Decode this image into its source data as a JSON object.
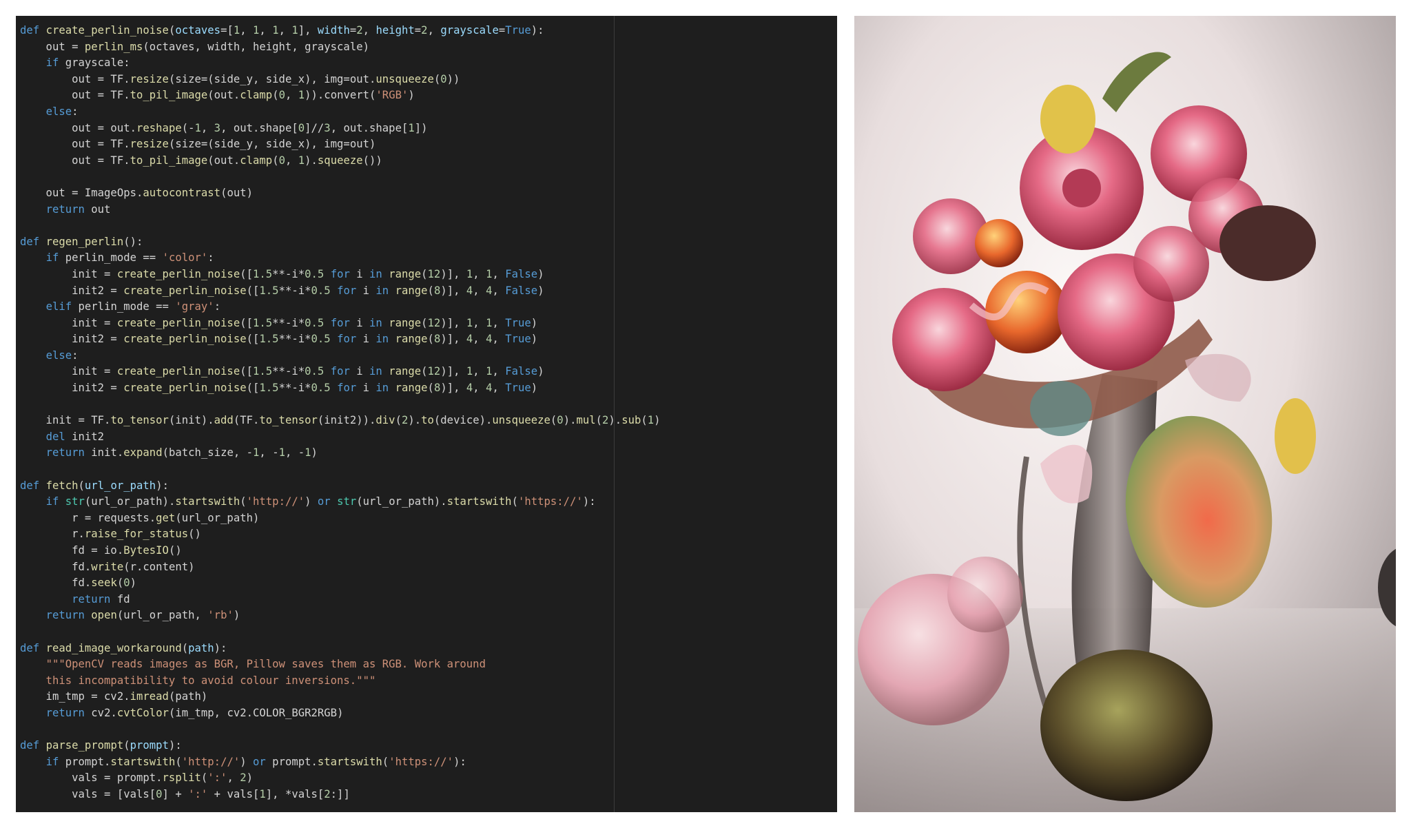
{
  "code_lines": [
    [
      [
        "kw",
        "def "
      ],
      [
        "fn",
        "create_perlin_noise"
      ],
      [
        "p",
        "("
      ],
      [
        "pm",
        "octaves"
      ],
      [
        "p",
        "=["
      ],
      [
        "nm",
        "1"
      ],
      [
        "p",
        ", "
      ],
      [
        "nm",
        "1"
      ],
      [
        "p",
        ", "
      ],
      [
        "nm",
        "1"
      ],
      [
        "p",
        ", "
      ],
      [
        "nm",
        "1"
      ],
      [
        "p",
        "], "
      ],
      [
        "pm",
        "width"
      ],
      [
        "p",
        "="
      ],
      [
        "nm",
        "2"
      ],
      [
        "p",
        ", "
      ],
      [
        "pm",
        "height"
      ],
      [
        "p",
        "="
      ],
      [
        "nm",
        "2"
      ],
      [
        "p",
        ", "
      ],
      [
        "pm",
        "grayscale"
      ],
      [
        "p",
        "="
      ],
      [
        "kw",
        "True"
      ],
      [
        "p",
        "):"
      ]
    ],
    [
      [
        "p",
        "    out = "
      ],
      [
        "fn",
        "perlin_ms"
      ],
      [
        "p",
        "(octaves, width, height, grayscale)"
      ]
    ],
    [
      [
        "p",
        "    "
      ],
      [
        "kw",
        "if"
      ],
      [
        "p",
        " grayscale:"
      ]
    ],
    [
      [
        "p",
        "        out = TF."
      ],
      [
        "fn",
        "resize"
      ],
      [
        "p",
        "(size=(side_y, side_x), img=out."
      ],
      [
        "fn",
        "unsqueeze"
      ],
      [
        "p",
        "("
      ],
      [
        "nm",
        "0"
      ],
      [
        "p",
        "))"
      ]
    ],
    [
      [
        "p",
        "        out = TF."
      ],
      [
        "fn",
        "to_pil_image"
      ],
      [
        "p",
        "(out."
      ],
      [
        "fn",
        "clamp"
      ],
      [
        "p",
        "("
      ],
      [
        "nm",
        "0"
      ],
      [
        "p",
        ", "
      ],
      [
        "nm",
        "1"
      ],
      [
        "p",
        ")).convert("
      ],
      [
        "st",
        "'RGB'"
      ],
      [
        "p",
        ")"
      ]
    ],
    [
      [
        "p",
        "    "
      ],
      [
        "kw",
        "else"
      ],
      [
        "p",
        ":"
      ]
    ],
    [
      [
        "p",
        "        out = out."
      ],
      [
        "fn",
        "reshape"
      ],
      [
        "p",
        "(-"
      ],
      [
        "nm",
        "1"
      ],
      [
        "p",
        ", "
      ],
      [
        "nm",
        "3"
      ],
      [
        "p",
        ", out.shape["
      ],
      [
        "nm",
        "0"
      ],
      [
        "p",
        "]//"
      ],
      [
        "nm",
        "3"
      ],
      [
        "p",
        ", out.shape["
      ],
      [
        "nm",
        "1"
      ],
      [
        "p",
        "])"
      ]
    ],
    [
      [
        "p",
        "        out = TF."
      ],
      [
        "fn",
        "resize"
      ],
      [
        "p",
        "(size=(side_y, side_x), img=out)"
      ]
    ],
    [
      [
        "p",
        "        out = TF."
      ],
      [
        "fn",
        "to_pil_image"
      ],
      [
        "p",
        "(out."
      ],
      [
        "fn",
        "clamp"
      ],
      [
        "p",
        "("
      ],
      [
        "nm",
        "0"
      ],
      [
        "p",
        ", "
      ],
      [
        "nm",
        "1"
      ],
      [
        "p",
        ")."
      ],
      [
        "fn",
        "squeeze"
      ],
      [
        "p",
        "())"
      ]
    ],
    [],
    [
      [
        "p",
        "    out = ImageOps."
      ],
      [
        "fn",
        "autocontrast"
      ],
      [
        "p",
        "(out)"
      ]
    ],
    [
      [
        "p",
        "    "
      ],
      [
        "kw",
        "return"
      ],
      [
        "p",
        " out"
      ]
    ],
    [],
    [
      [
        "kw",
        "def "
      ],
      [
        "fn",
        "regen_perlin"
      ],
      [
        "p",
        "():"
      ]
    ],
    [
      [
        "p",
        "    "
      ],
      [
        "kw",
        "if"
      ],
      [
        "p",
        " perlin_mode == "
      ],
      [
        "st",
        "'color'"
      ],
      [
        "p",
        ":"
      ]
    ],
    [
      [
        "p",
        "        init = "
      ],
      [
        "fn",
        "create_perlin_noise"
      ],
      [
        "p",
        "(["
      ],
      [
        "nm",
        "1.5"
      ],
      [
        "p",
        "**-i*"
      ],
      [
        "nm",
        "0.5"
      ],
      [
        "p",
        " "
      ],
      [
        "kw",
        "for"
      ],
      [
        "p",
        " i "
      ],
      [
        "kw",
        "in"
      ],
      [
        "p",
        " "
      ],
      [
        "fn",
        "range"
      ],
      [
        "p",
        "("
      ],
      [
        "nm",
        "12"
      ],
      [
        "p",
        ")], "
      ],
      [
        "nm",
        "1"
      ],
      [
        "p",
        ", "
      ],
      [
        "nm",
        "1"
      ],
      [
        "p",
        ", "
      ],
      [
        "kw",
        "False"
      ],
      [
        "p",
        ")"
      ]
    ],
    [
      [
        "p",
        "        init2 = "
      ],
      [
        "fn",
        "create_perlin_noise"
      ],
      [
        "p",
        "(["
      ],
      [
        "nm",
        "1.5"
      ],
      [
        "p",
        "**-i*"
      ],
      [
        "nm",
        "0.5"
      ],
      [
        "p",
        " "
      ],
      [
        "kw",
        "for"
      ],
      [
        "p",
        " i "
      ],
      [
        "kw",
        "in"
      ],
      [
        "p",
        " "
      ],
      [
        "fn",
        "range"
      ],
      [
        "p",
        "("
      ],
      [
        "nm",
        "8"
      ],
      [
        "p",
        ")], "
      ],
      [
        "nm",
        "4"
      ],
      [
        "p",
        ", "
      ],
      [
        "nm",
        "4"
      ],
      [
        "p",
        ", "
      ],
      [
        "kw",
        "False"
      ],
      [
        "p",
        ")"
      ]
    ],
    [
      [
        "p",
        "    "
      ],
      [
        "kw",
        "elif"
      ],
      [
        "p",
        " perlin_mode == "
      ],
      [
        "st",
        "'gray'"
      ],
      [
        "p",
        ":"
      ]
    ],
    [
      [
        "p",
        "        init = "
      ],
      [
        "fn",
        "create_perlin_noise"
      ],
      [
        "p",
        "(["
      ],
      [
        "nm",
        "1.5"
      ],
      [
        "p",
        "**-i*"
      ],
      [
        "nm",
        "0.5"
      ],
      [
        "p",
        " "
      ],
      [
        "kw",
        "for"
      ],
      [
        "p",
        " i "
      ],
      [
        "kw",
        "in"
      ],
      [
        "p",
        " "
      ],
      [
        "fn",
        "range"
      ],
      [
        "p",
        "("
      ],
      [
        "nm",
        "12"
      ],
      [
        "p",
        ")], "
      ],
      [
        "nm",
        "1"
      ],
      [
        "p",
        ", "
      ],
      [
        "nm",
        "1"
      ],
      [
        "p",
        ", "
      ],
      [
        "kw",
        "True"
      ],
      [
        "p",
        ")"
      ]
    ],
    [
      [
        "p",
        "        init2 = "
      ],
      [
        "fn",
        "create_perlin_noise"
      ],
      [
        "p",
        "(["
      ],
      [
        "nm",
        "1.5"
      ],
      [
        "p",
        "**-i*"
      ],
      [
        "nm",
        "0.5"
      ],
      [
        "p",
        " "
      ],
      [
        "kw",
        "for"
      ],
      [
        "p",
        " i "
      ],
      [
        "kw",
        "in"
      ],
      [
        "p",
        " "
      ],
      [
        "fn",
        "range"
      ],
      [
        "p",
        "("
      ],
      [
        "nm",
        "8"
      ],
      [
        "p",
        ")], "
      ],
      [
        "nm",
        "4"
      ],
      [
        "p",
        ", "
      ],
      [
        "nm",
        "4"
      ],
      [
        "p",
        ", "
      ],
      [
        "kw",
        "True"
      ],
      [
        "p",
        ")"
      ]
    ],
    [
      [
        "p",
        "    "
      ],
      [
        "kw",
        "else"
      ],
      [
        "p",
        ":"
      ]
    ],
    [
      [
        "p",
        "        init = "
      ],
      [
        "fn",
        "create_perlin_noise"
      ],
      [
        "p",
        "(["
      ],
      [
        "nm",
        "1.5"
      ],
      [
        "p",
        "**-i*"
      ],
      [
        "nm",
        "0.5"
      ],
      [
        "p",
        " "
      ],
      [
        "kw",
        "for"
      ],
      [
        "p",
        " i "
      ],
      [
        "kw",
        "in"
      ],
      [
        "p",
        " "
      ],
      [
        "fn",
        "range"
      ],
      [
        "p",
        "("
      ],
      [
        "nm",
        "12"
      ],
      [
        "p",
        ")], "
      ],
      [
        "nm",
        "1"
      ],
      [
        "p",
        ", "
      ],
      [
        "nm",
        "1"
      ],
      [
        "p",
        ", "
      ],
      [
        "kw",
        "False"
      ],
      [
        "p",
        ")"
      ]
    ],
    [
      [
        "p",
        "        init2 = "
      ],
      [
        "fn",
        "create_perlin_noise"
      ],
      [
        "p",
        "(["
      ],
      [
        "nm",
        "1.5"
      ],
      [
        "p",
        "**-i*"
      ],
      [
        "nm",
        "0.5"
      ],
      [
        "p",
        " "
      ],
      [
        "kw",
        "for"
      ],
      [
        "p",
        " i "
      ],
      [
        "kw",
        "in"
      ],
      [
        "p",
        " "
      ],
      [
        "fn",
        "range"
      ],
      [
        "p",
        "("
      ],
      [
        "nm",
        "8"
      ],
      [
        "p",
        ")], "
      ],
      [
        "nm",
        "4"
      ],
      [
        "p",
        ", "
      ],
      [
        "nm",
        "4"
      ],
      [
        "p",
        ", "
      ],
      [
        "kw",
        "True"
      ],
      [
        "p",
        ")"
      ]
    ],
    [],
    [
      [
        "p",
        "    init = TF."
      ],
      [
        "fn",
        "to_tensor"
      ],
      [
        "p",
        "(init)."
      ],
      [
        "fn",
        "add"
      ],
      [
        "p",
        "(TF."
      ],
      [
        "fn",
        "to_tensor"
      ],
      [
        "p",
        "(init2))."
      ],
      [
        "fn",
        "div"
      ],
      [
        "p",
        "("
      ],
      [
        "nm",
        "2"
      ],
      [
        "p",
        ")."
      ],
      [
        "fn",
        "to"
      ],
      [
        "p",
        "(device)."
      ],
      [
        "fn",
        "unsqueeze"
      ],
      [
        "p",
        "("
      ],
      [
        "nm",
        "0"
      ],
      [
        "p",
        ")."
      ],
      [
        "fn",
        "mul"
      ],
      [
        "p",
        "("
      ],
      [
        "nm",
        "2"
      ],
      [
        "p",
        ")."
      ],
      [
        "fn",
        "sub"
      ],
      [
        "p",
        "("
      ],
      [
        "nm",
        "1"
      ],
      [
        "p",
        ")"
      ]
    ],
    [
      [
        "p",
        "    "
      ],
      [
        "kw",
        "del"
      ],
      [
        "p",
        " init2"
      ]
    ],
    [
      [
        "p",
        "    "
      ],
      [
        "kw",
        "return"
      ],
      [
        "p",
        " init."
      ],
      [
        "fn",
        "expand"
      ],
      [
        "p",
        "(batch_size, -"
      ],
      [
        "nm",
        "1"
      ],
      [
        "p",
        ", -"
      ],
      [
        "nm",
        "1"
      ],
      [
        "p",
        ", -"
      ],
      [
        "nm",
        "1"
      ],
      [
        "p",
        ")"
      ]
    ],
    [],
    [
      [
        "kw",
        "def "
      ],
      [
        "fn",
        "fetch"
      ],
      [
        "p",
        "("
      ],
      [
        "pm",
        "url_or_path"
      ],
      [
        "p",
        "):"
      ]
    ],
    [
      [
        "p",
        "    "
      ],
      [
        "kw",
        "if"
      ],
      [
        "p",
        " "
      ],
      [
        "bt",
        "str"
      ],
      [
        "p",
        "(url_or_path)."
      ],
      [
        "fn",
        "startswith"
      ],
      [
        "p",
        "("
      ],
      [
        "st",
        "'http://'"
      ],
      [
        "p",
        ") "
      ],
      [
        "kw",
        "or"
      ],
      [
        "p",
        " "
      ],
      [
        "bt",
        "str"
      ],
      [
        "p",
        "(url_or_path)."
      ],
      [
        "fn",
        "startswith"
      ],
      [
        "p",
        "("
      ],
      [
        "st",
        "'https://'"
      ],
      [
        "p",
        "):"
      ]
    ],
    [
      [
        "p",
        "        r = requests."
      ],
      [
        "fn",
        "get"
      ],
      [
        "p",
        "(url_or_path)"
      ]
    ],
    [
      [
        "p",
        "        r."
      ],
      [
        "fn",
        "raise_for_status"
      ],
      [
        "p",
        "()"
      ]
    ],
    [
      [
        "p",
        "        fd = io."
      ],
      [
        "fn",
        "BytesIO"
      ],
      [
        "p",
        "()"
      ]
    ],
    [
      [
        "p",
        "        fd."
      ],
      [
        "fn",
        "write"
      ],
      [
        "p",
        "(r.content)"
      ]
    ],
    [
      [
        "p",
        "        fd."
      ],
      [
        "fn",
        "seek"
      ],
      [
        "p",
        "("
      ],
      [
        "nm",
        "0"
      ],
      [
        "p",
        ")"
      ]
    ],
    [
      [
        "p",
        "        "
      ],
      [
        "kw",
        "return"
      ],
      [
        "p",
        " fd"
      ]
    ],
    [
      [
        "p",
        "    "
      ],
      [
        "kw",
        "return"
      ],
      [
        "p",
        " "
      ],
      [
        "fn",
        "open"
      ],
      [
        "p",
        "(url_or_path, "
      ],
      [
        "st",
        "'rb'"
      ],
      [
        "p",
        ")"
      ]
    ],
    [],
    [
      [
        "kw",
        "def "
      ],
      [
        "fn",
        "read_image_workaround"
      ],
      [
        "p",
        "("
      ],
      [
        "pm",
        "path"
      ],
      [
        "p",
        "):"
      ]
    ],
    [
      [
        "p",
        "    "
      ],
      [
        "ds",
        "\"\"\"OpenCV reads images as BGR, Pillow saves them as RGB. Work around"
      ]
    ],
    [
      [
        "ds",
        "    this incompatibility to avoid colour inversions.\"\"\""
      ]
    ],
    [
      [
        "p",
        "    im_tmp = cv2."
      ],
      [
        "fn",
        "imread"
      ],
      [
        "p",
        "(path)"
      ]
    ],
    [
      [
        "p",
        "    "
      ],
      [
        "kw",
        "return"
      ],
      [
        "p",
        " cv2."
      ],
      [
        "fn",
        "cvtColor"
      ],
      [
        "p",
        "(im_tmp, cv2.COLOR_BGR2RGB)"
      ]
    ],
    [],
    [
      [
        "kw",
        "def "
      ],
      [
        "fn",
        "parse_prompt"
      ],
      [
        "p",
        "("
      ],
      [
        "pm",
        "prompt"
      ],
      [
        "p",
        "):"
      ]
    ],
    [
      [
        "p",
        "    "
      ],
      [
        "kw",
        "if"
      ],
      [
        "p",
        " prompt."
      ],
      [
        "fn",
        "startswith"
      ],
      [
        "p",
        "("
      ],
      [
        "st",
        "'http://'"
      ],
      [
        "p",
        ") "
      ],
      [
        "kw",
        "or"
      ],
      [
        "p",
        " prompt."
      ],
      [
        "fn",
        "startswith"
      ],
      [
        "p",
        "("
      ],
      [
        "st",
        "'https://'"
      ],
      [
        "p",
        "):"
      ]
    ],
    [
      [
        "p",
        "        vals = prompt."
      ],
      [
        "fn",
        "rsplit"
      ],
      [
        "p",
        "("
      ],
      [
        "st",
        "':'"
      ],
      [
        "p",
        ", "
      ],
      [
        "nm",
        "2"
      ],
      [
        "p",
        ")"
      ]
    ],
    [
      [
        "p",
        "        vals = [vals["
      ],
      [
        "nm",
        "0"
      ],
      [
        "p",
        "] + "
      ],
      [
        "st",
        "':'"
      ],
      [
        "p",
        " + vals["
      ],
      [
        "nm",
        "1"
      ],
      [
        "p",
        "], *vals["
      ],
      [
        "nm",
        "2"
      ],
      [
        "p",
        ":]]"
      ]
    ]
  ],
  "colors": {
    "editor_bg": "#1e1e1e",
    "keyword": "#569cd6",
    "function": "#dcdcaa",
    "parameter": "#9cdcfe",
    "string": "#ce9178",
    "number": "#b5cea8",
    "builtin": "#4ec9b0",
    "plain": "#d4d4d4"
  }
}
